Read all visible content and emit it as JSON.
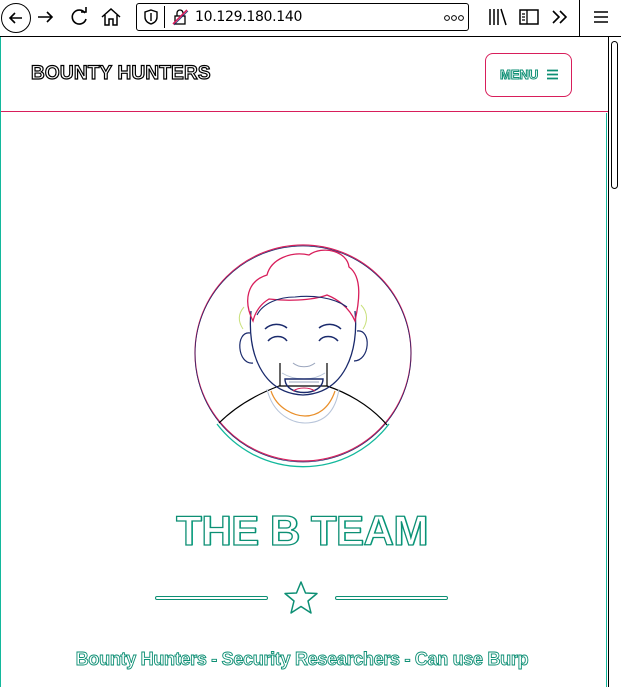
{
  "browser": {
    "url": "10.129.180.140",
    "icons": [
      "back-arrow-icon",
      "forward-arrow-icon",
      "reload-icon",
      "home-icon",
      "shield-icon",
      "insecure-lock-icon",
      "page-actions-icon",
      "library-icon",
      "sidebar-icon",
      "overflow-chevrons-icon",
      "hamburger-menu-icon"
    ]
  },
  "navbar": {
    "brand": "BOUNTY HUNTERS",
    "menu_label": "MENU"
  },
  "hero": {
    "avatar_icon": "team-avatar-illustration",
    "title": "THE B TEAM",
    "divider_icon": "star-icon",
    "subtitle": "Bounty Hunters - Security Researchers - Can use Burp"
  },
  "colors": {
    "accent_teal": "#0d8f74",
    "accent_crimson": "#d81e5b",
    "outline_navy": "#1a2a6c"
  }
}
